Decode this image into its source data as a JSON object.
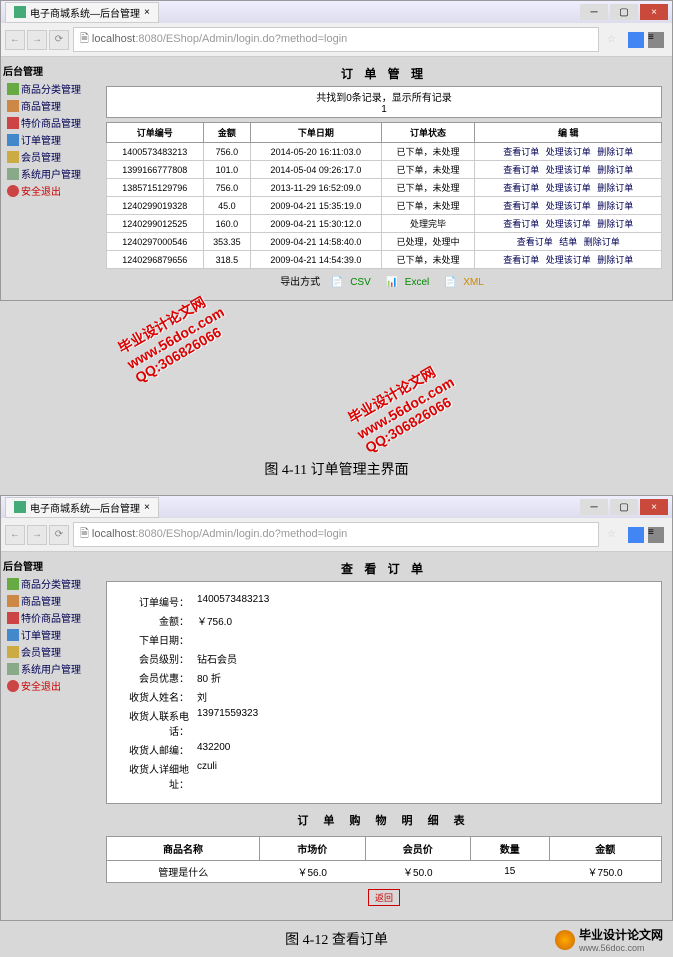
{
  "browser": {
    "tab_title": "电子商城系统—后台管理",
    "url_host": "localhost",
    "url_port": ":8080",
    "url_path": "/EShop/Admin/login.do?method=login"
  },
  "sidebar": {
    "title": "后台管理",
    "items": [
      {
        "label": "商品分类管理"
      },
      {
        "label": "商品管理"
      },
      {
        "label": "特价商品管理"
      },
      {
        "label": "订单管理"
      },
      {
        "label": "会员管理"
      },
      {
        "label": "系统用户管理"
      },
      {
        "label": "安全退出"
      }
    ]
  },
  "page1": {
    "title": "订 单 管 理",
    "record_info": "共找到0条记录，显示所有记录",
    "page_num": "1",
    "headers": [
      "订单编号",
      "金额",
      "下单日期",
      "订单状态",
      "编 辑"
    ],
    "rows": [
      {
        "id": "1400573483213",
        "amount": "756.0",
        "date": "2014-05-20 16:11:03.0",
        "status": "已下单，未处理",
        "actions": "查看订单 处理该订单 删除订单"
      },
      {
        "id": "1399166777808",
        "amount": "101.0",
        "date": "2014-05-04 09:26:17.0",
        "status": "已下单，未处理",
        "actions": "查看订单 处理该订单 删除订单"
      },
      {
        "id": "1385715129796",
        "amount": "756.0",
        "date": "2013-11-29 16:52:09.0",
        "status": "已下单，未处理",
        "actions": "查看订单 处理该订单 删除订单"
      },
      {
        "id": "1240299019328",
        "amount": "45.0",
        "date": "2009-04-21 15:35:19.0",
        "status": "已下单，未处理",
        "actions": "查看订单 处理该订单 删除订单"
      },
      {
        "id": "1240299012525",
        "amount": "160.0",
        "date": "2009-04-21 15:30:12.0",
        "status": "处理完毕",
        "actions": "查看订单 处理该订单 删除订单"
      },
      {
        "id": "1240297000546",
        "amount": "353.35",
        "date": "2009-04-21 14:58:40.0",
        "status": "已处理，处理中",
        "actions": "查看订单 结单 删除订单"
      },
      {
        "id": "1240296879656",
        "amount": "318.5",
        "date": "2009-04-21 14:54:39.0",
        "status": "已下单，未处理",
        "actions": "查看订单 处理该订单 删除订单"
      }
    ],
    "export_label": "导出方式",
    "export_csv": "CSV",
    "export_excel": "Excel",
    "export_xml": "XML",
    "caption": "图 4-11 订单管理主界面"
  },
  "page2": {
    "title": "查 看 订 单",
    "details": [
      {
        "label": "订单编号：",
        "value": "1400573483213"
      },
      {
        "label": "金额：",
        "value": "￥756.0"
      },
      {
        "label": "下单日期：",
        "value": ""
      },
      {
        "label": "会员级别：",
        "value": "钻石会员"
      },
      {
        "label": "会员优惠：",
        "value": "80 折"
      },
      {
        "label": "收货人姓名：",
        "value": "刘"
      },
      {
        "label": "收货人联系电话：",
        "value": "13971559323"
      },
      {
        "label": "收货人邮编：",
        "value": "432200"
      },
      {
        "label": "收货人详细地址：",
        "value": "czuli"
      }
    ],
    "sub_title": "订 单 购 物 明 细 表",
    "item_headers": [
      "商品名称",
      "市场价",
      "会员价",
      "数量",
      "金额"
    ],
    "item_row": {
      "name": "管理是什么",
      "market": "￥56.0",
      "member": "￥50.0",
      "qty": "15",
      "total": "￥750.0"
    },
    "stamp": "返回",
    "caption": "图 4-12 查看订单"
  },
  "watermark": {
    "line1": "毕业设计论文网",
    "line2": "www.56doc.com",
    "line3": "QQ:306826066"
  },
  "footer": {
    "text1": "毕业设计论文网",
    "text2": "www.56doc.com"
  }
}
